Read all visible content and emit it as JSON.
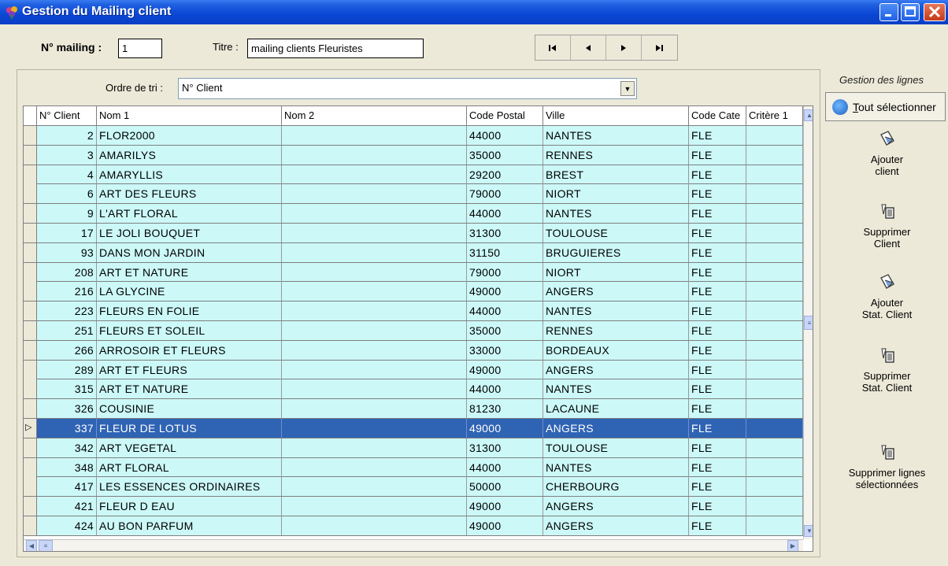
{
  "window": {
    "title": "Gestion du Mailing client"
  },
  "header": {
    "mailing_label": "N° mailing :",
    "mailing_value": "1",
    "titre_label": "Titre :",
    "titre_value": "mailing clients Fleuristes",
    "nav": [
      "first-record",
      "previous-record",
      "next-record",
      "last-record"
    ]
  },
  "sort": {
    "label": "Ordre de tri :",
    "value": "N° Client"
  },
  "grid": {
    "columns": [
      "N° Client",
      "Nom 1",
      "Nom 2",
      "Code Postal",
      "Ville",
      "Code Cate",
      "Critère 1"
    ],
    "selected_row": 15,
    "rows": [
      [
        "2",
        "FLOR2000",
        "",
        "44000",
        "NANTES",
        "FLE",
        ""
      ],
      [
        "3",
        "AMARILYS",
        "",
        "35000",
        "RENNES",
        "FLE",
        ""
      ],
      [
        "4",
        "AMARYLLIS",
        "",
        "29200",
        "BREST",
        "FLE",
        ""
      ],
      [
        "6",
        "ART DES FLEURS",
        "",
        "79000",
        "NIORT",
        "FLE",
        ""
      ],
      [
        "9",
        "L'ART FLORAL",
        "",
        "44000",
        "NANTES",
        "FLE",
        ""
      ],
      [
        "17",
        "LE JOLI BOUQUET",
        "",
        "31300",
        "TOULOUSE",
        "FLE",
        ""
      ],
      [
        "93",
        "DANS MON JARDIN",
        "",
        "31150",
        "BRUGUIERES",
        "FLE",
        ""
      ],
      [
        "208",
        "ART ET NATURE",
        "",
        "79000",
        "NIORT",
        "FLE",
        ""
      ],
      [
        "216",
        "LA GLYCINE",
        "",
        "49000",
        "ANGERS",
        "FLE",
        ""
      ],
      [
        "223",
        "FLEURS EN FOLIE",
        "",
        "44000",
        "NANTES",
        "FLE",
        ""
      ],
      [
        "251",
        "FLEURS ET SOLEIL",
        "",
        "35000",
        "RENNES",
        "FLE",
        ""
      ],
      [
        "266",
        "ARROSOIR ET FLEURS",
        "",
        "33000",
        "BORDEAUX",
        "FLE",
        ""
      ],
      [
        "289",
        "ART ET FLEURS",
        "",
        "49000",
        "ANGERS",
        "FLE",
        ""
      ],
      [
        "315",
        "ART ET NATURE",
        "",
        "44000",
        "NANTES",
        "FLE",
        ""
      ],
      [
        "326",
        "COUSINIE",
        "",
        "81230",
        "LACAUNE",
        "FLE",
        ""
      ],
      [
        "337",
        "FLEUR DE LOTUS",
        "",
        "49000",
        "ANGERS",
        "FLE",
        ""
      ],
      [
        "342",
        "ART VEGETAL",
        "",
        "31300",
        "TOULOUSE",
        "FLE",
        ""
      ],
      [
        "348",
        "ART FLORAL",
        "",
        "44000",
        "NANTES",
        "FLE",
        ""
      ],
      [
        "417",
        "LES ESSENCES ORDINAIRES",
        "",
        "50000",
        "CHERBOURG",
        "FLE",
        ""
      ],
      [
        "421",
        "FLEUR D EAU",
        "",
        "49000",
        "ANGERS",
        "FLE",
        ""
      ],
      [
        "424",
        "AU BON PARFUM",
        "",
        "49000",
        "ANGERS",
        "FLE",
        ""
      ]
    ]
  },
  "side": {
    "title": "Gestion des lignes",
    "select_all": "Tout sélectionner",
    "actions": [
      {
        "label1": "Ajouter",
        "label2": "client",
        "icon": "add-card-icon"
      },
      {
        "label1": "Supprimer",
        "label2": "Client",
        "icon": "trash-icon"
      },
      {
        "label1": "Ajouter",
        "label2": "Stat. Client",
        "icon": "add-card-icon"
      },
      {
        "label1": "Supprimer",
        "label2": "Stat. Client",
        "icon": "trash-icon"
      },
      {
        "label1": "Supprimer lignes",
        "label2": "sélectionnées",
        "icon": "trash-icon"
      }
    ]
  },
  "colors": {
    "row_bg": "#ccf8f8",
    "selected_bg": "#2f63b4",
    "titlebar": "#0a46d4"
  }
}
